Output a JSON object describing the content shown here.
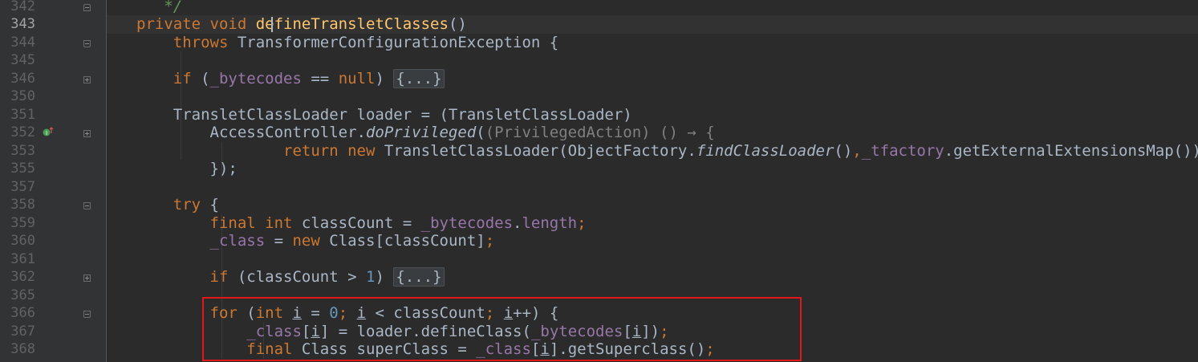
{
  "editor": {
    "current_line": "343",
    "lines": [
      {
        "num": "342",
        "parts": [
          {
            "t": "   */",
            "c": "cmt"
          }
        ]
      },
      {
        "num": "343",
        "parts": [
          {
            "t": "private ",
            "c": "kw"
          },
          {
            "t": "void ",
            "c": "kw"
          },
          {
            "t": "defineTransletClasses",
            "c": "fn"
          },
          {
            "t": "()",
            "c": ""
          }
        ]
      },
      {
        "num": "344",
        "parts": [
          {
            "t": "    throws ",
            "c": "kw"
          },
          {
            "t": "TransformerConfigurationException {",
            "c": ""
          }
        ]
      },
      {
        "num": "345",
        "parts": []
      },
      {
        "num": "346",
        "parts": [
          {
            "t": "    if ",
            "c": "kw"
          },
          {
            "t": "(",
            "c": ""
          },
          {
            "t": "_bytecodes",
            "c": "fld"
          },
          {
            "t": " == ",
            "c": ""
          },
          {
            "t": "null",
            "c": "kw"
          },
          {
            "t": ") ",
            "c": ""
          },
          {
            "t": "{...}",
            "c": "collapsed"
          }
        ]
      },
      {
        "num": "350",
        "parts": []
      },
      {
        "num": "351",
        "parts": [
          {
            "t": "    TransletClassLoader loader = (TransletClassLoader)",
            "c": ""
          }
        ]
      },
      {
        "num": "352",
        "parts": [
          {
            "t": "        AccessController.",
            "c": ""
          },
          {
            "t": "doPrivileged",
            "c": "ital"
          },
          {
            "t": "(",
            "c": ""
          },
          {
            "t": "(PrivilegedAction) () → {",
            "c": "lambda-hint"
          }
        ]
      },
      {
        "num": "353",
        "parts": [
          {
            "t": "                ",
            "c": ""
          },
          {
            "t": "return new ",
            "c": "kw"
          },
          {
            "t": "TransletClassLoader(ObjectFactory.",
            "c": ""
          },
          {
            "t": "findClassLoader",
            "c": "ital"
          },
          {
            "t": "()",
            "c": ""
          },
          {
            "t": ",",
            "c": "kw"
          },
          {
            "t": "_tfactory",
            "c": "fld"
          },
          {
            "t": ".getExternalExtensionsMap())",
            "c": ""
          }
        ]
      },
      {
        "num": "355",
        "parts": [
          {
            "t": "        });",
            "c": ""
          }
        ]
      },
      {
        "num": "357",
        "parts": []
      },
      {
        "num": "358",
        "parts": [
          {
            "t": "    try ",
            "c": "kw"
          },
          {
            "t": "{",
            "c": ""
          }
        ]
      },
      {
        "num": "359",
        "parts": [
          {
            "t": "        final int ",
            "c": "kw"
          },
          {
            "t": "classCount = ",
            "c": ""
          },
          {
            "t": "_bytecodes",
            "c": "fld"
          },
          {
            "t": ".",
            "c": ""
          },
          {
            "t": "length",
            "c": "fld"
          },
          {
            "t": ";",
            "c": "kw"
          }
        ]
      },
      {
        "num": "360",
        "parts": [
          {
            "t": "        ",
            "c": ""
          },
          {
            "t": "_class",
            "c": "fld"
          },
          {
            "t": " = ",
            "c": ""
          },
          {
            "t": "new ",
            "c": "kw"
          },
          {
            "t": "Class[classCount]",
            "c": ""
          },
          {
            "t": ";",
            "c": "kw"
          }
        ]
      },
      {
        "num": "361",
        "parts": []
      },
      {
        "num": "362",
        "parts": [
          {
            "t": "        if ",
            "c": "kw"
          },
          {
            "t": "(classCount > ",
            "c": ""
          },
          {
            "t": "1",
            "c": "num"
          },
          {
            "t": ") ",
            "c": ""
          },
          {
            "t": "{...}",
            "c": "collapsed"
          }
        ]
      },
      {
        "num": "365",
        "parts": []
      },
      {
        "num": "366",
        "parts": [
          {
            "t": "        for ",
            "c": "kw"
          },
          {
            "t": "(",
            "c": ""
          },
          {
            "t": "int ",
            "c": "kw"
          },
          {
            "t": "i",
            "c": "underl"
          },
          {
            "t": " = ",
            "c": ""
          },
          {
            "t": "0",
            "c": "num"
          },
          {
            "t": "; ",
            "c": "kw"
          },
          {
            "t": "i",
            "c": "underl"
          },
          {
            "t": " < classCount",
            "c": ""
          },
          {
            "t": "; ",
            "c": "kw"
          },
          {
            "t": "i",
            "c": "underl"
          },
          {
            "t": "++) {",
            "c": ""
          }
        ]
      },
      {
        "num": "367",
        "parts": [
          {
            "t": "            ",
            "c": ""
          },
          {
            "t": "_class",
            "c": "fld"
          },
          {
            "t": "[",
            "c": ""
          },
          {
            "t": "i",
            "c": "underl"
          },
          {
            "t": "] = loader.defineClass(",
            "c": ""
          },
          {
            "t": "_bytecodes",
            "c": "fld"
          },
          {
            "t": "[",
            "c": ""
          },
          {
            "t": "i",
            "c": "underl"
          },
          {
            "t": "])",
            "c": ""
          },
          {
            "t": ";",
            "c": "kw"
          }
        ]
      },
      {
        "num": "368",
        "parts": [
          {
            "t": "            ",
            "c": ""
          },
          {
            "t": "final ",
            "c": "kw"
          },
          {
            "t": "Class superClass = ",
            "c": ""
          },
          {
            "t": "_class",
            "c": "fld"
          },
          {
            "t": "[",
            "c": ""
          },
          {
            "t": "i",
            "c": "underl"
          },
          {
            "t": "].getSuperclass()",
            "c": ""
          },
          {
            "t": ";",
            "c": "kw"
          }
        ]
      }
    ],
    "gutter_icon": "implements-override-icon",
    "colors": {
      "background": "#2b2b2b",
      "gutter": "#313335",
      "keyword": "#cc7832",
      "method": "#ffc66d",
      "field": "#9876aa",
      "number": "#6897bb",
      "text": "#a9b7c6",
      "comment": "#629755",
      "highlight_box": "#e01818"
    }
  }
}
